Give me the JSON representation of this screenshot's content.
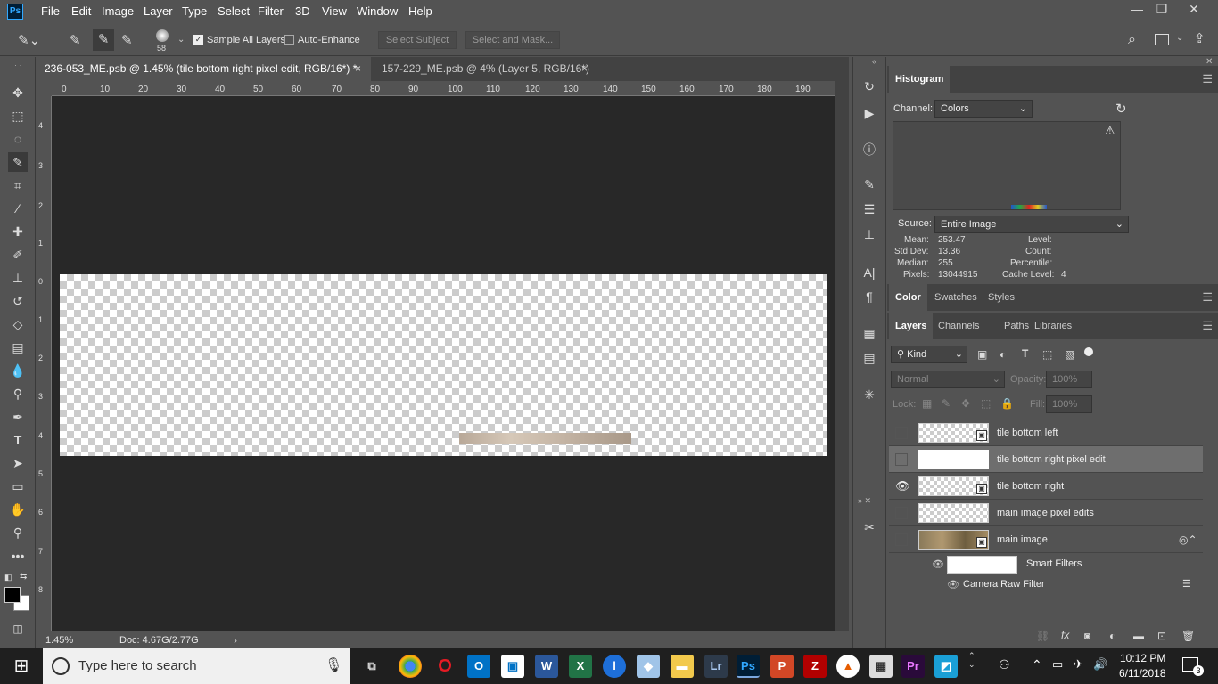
{
  "app": {
    "logo": "Ps"
  },
  "menu": [
    "File",
    "Edit",
    "Image",
    "Layer",
    "Type",
    "Select",
    "Filter",
    "3D",
    "View",
    "Window",
    "Help"
  ],
  "window_controls": {
    "minimize": "—",
    "restore": "❐",
    "close": "✕"
  },
  "options": {
    "brush_size": "58",
    "sample_all_layers": "Sample All Layers",
    "auto_enhance": "Auto-Enhance",
    "select_subject": "Select Subject",
    "select_and_mask": "Select and Mask..."
  },
  "tabs": [
    {
      "label": "236-053_ME.psb @ 1.45% (tile bottom right pixel edit, RGB/16*) *",
      "close": "×"
    },
    {
      "label": "157-229_ME.psb @ 4% (Layer 5, RGB/16*)",
      "close": "×"
    }
  ],
  "ruler_top": [
    "0",
    "10",
    "20",
    "30",
    "40",
    "50",
    "60",
    "70",
    "80",
    "90",
    "100",
    "110",
    "120",
    "130",
    "140",
    "150",
    "160",
    "170",
    "180",
    "190"
  ],
  "ruler_left": [
    "4",
    "3",
    "2",
    "1",
    "0",
    "1",
    "2",
    "3",
    "4",
    "5",
    "6",
    "7",
    "8"
  ],
  "status": {
    "zoom": "1.45%",
    "doc": "Doc: 4.67G/2.77G"
  },
  "histogram": {
    "tab": "Histogram",
    "channel_label": "Channel:",
    "channel_value": "Colors",
    "source_label": "Source:",
    "source_value": "Entire Image",
    "stats_left": [
      {
        "label": "Mean:",
        "value": "253.47"
      },
      {
        "label": "Std Dev:",
        "value": "13.36"
      },
      {
        "label": "Median:",
        "value": "255"
      },
      {
        "label": "Pixels:",
        "value": "13044915"
      }
    ],
    "stats_right": [
      {
        "label": "Level:",
        "value": ""
      },
      {
        "label": "Count:",
        "value": ""
      },
      {
        "label": "Percentile:",
        "value": ""
      },
      {
        "label": "Cache Level:",
        "value": "4"
      }
    ]
  },
  "color_tabs": [
    "Color",
    "Swatches",
    "Styles"
  ],
  "layer_tabs": [
    "Layers",
    "Channels",
    "Paths",
    "Libraries"
  ],
  "layers_panel": {
    "filter_kind": "Kind",
    "blend_mode": "Normal",
    "opacity_label": "Opacity:",
    "opacity_value": "100%",
    "lock_label": "Lock:",
    "fill_label": "Fill:",
    "fill_value": "100%"
  },
  "layers": [
    {
      "name": "tile bottom left",
      "visible": false,
      "selected": false
    },
    {
      "name": "tile bottom right pixel edit",
      "visible": false,
      "selected": true
    },
    {
      "name": "tile bottom right",
      "visible": true,
      "selected": false
    },
    {
      "name": "main image pixel edits",
      "visible": false,
      "selected": false
    },
    {
      "name": "main image",
      "visible": false,
      "selected": false
    }
  ],
  "smart_filters": {
    "label": "Smart Filters",
    "filter": "Camera Raw Filter"
  },
  "taskbar": {
    "search_placeholder": "Type here to search",
    "time": "10:12 PM",
    "date": "6/11/2018",
    "notifications": "3"
  },
  "colors": {
    "accent": "#31a8ff",
    "panel": "#535353",
    "canvas_bg": "#282828"
  }
}
